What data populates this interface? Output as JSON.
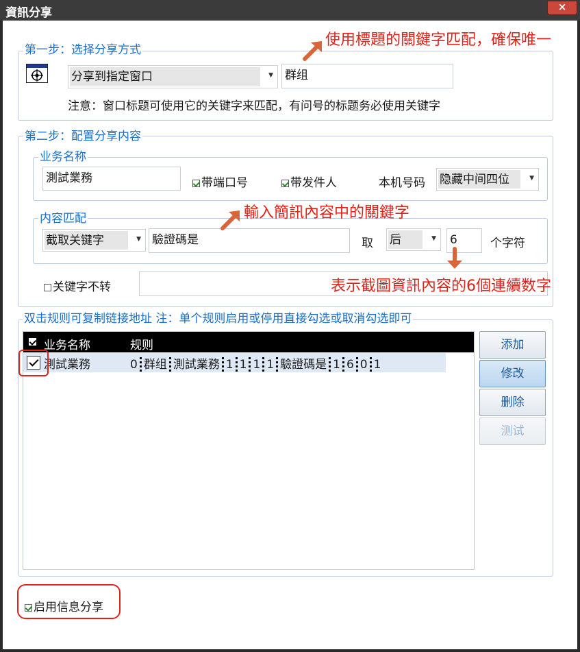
{
  "window": {
    "title": "資訊分享",
    "close": "×"
  },
  "step1": {
    "legend": "第一步：选择分享方式",
    "share_mode": "分享到指定窗口",
    "window_keyword": "群组",
    "note": "注意：窗口标题可使用它的关键字来匹配，有问号的标题务必使用关键字"
  },
  "step2": {
    "legend": "第二步：配置分享内容",
    "business": {
      "legend": "业务名称",
      "name_value": "測試業務",
      "with_port_label": "带端口号",
      "with_sender_label": "带发件人",
      "local_number_label": "本机号码",
      "local_number_mode": "隐藏中间四位"
    },
    "content": {
      "legend": "内容匹配",
      "match_mode": "截取关键字",
      "keyword_value": "驗證碼是",
      "take_label": "取",
      "direction": "后",
      "count_value": "6",
      "unit_label": "个字符"
    },
    "keyword_no_convert_label": "关键字不转",
    "keyword_no_convert_value": ""
  },
  "rules": {
    "legend": "双击规则可复制链接地址 注：单个规则启用或停用直接勾选或取消勾选即可",
    "header_name": "业务名称",
    "header_rule": "规则",
    "rows": [
      {
        "name": "測試業務",
        "rule_parts": [
          "0",
          "群组",
          "測試業務",
          "1",
          "1",
          "1",
          "1",
          "驗證碼是",
          "1",
          "6",
          "0",
          "1"
        ]
      }
    ],
    "buttons": {
      "add": "添加",
      "edit": "修改",
      "delete": "删除",
      "test": "测试"
    }
  },
  "enable_share_label": "启用信息分享",
  "annotations": {
    "a1": "使用標題的關鍵字匹配，確保唯一",
    "a2": "輸入簡訊內容中的關鍵字",
    "a3": "表示截圖資訊內容的6個連續数字"
  },
  "colors": {
    "legend": "#1a6fc9",
    "annotation": "#e0231a",
    "arrow": "#d9663a",
    "highlight": "#e0231a"
  }
}
